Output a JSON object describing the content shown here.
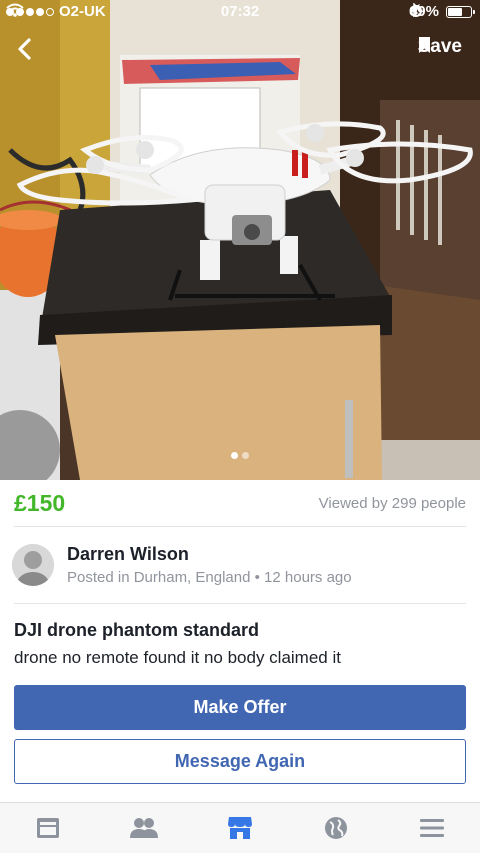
{
  "status_bar": {
    "carrier": "O2-UK",
    "time": "07:32",
    "battery_text": "69%",
    "battery_level": 0.69
  },
  "nav": {
    "save_label": "Save",
    "photo_count": 2,
    "active_photo": 1
  },
  "listing": {
    "price": "£150",
    "views": "Viewed by 299 people",
    "seller_name": "Darren Wilson",
    "seller_meta": "Posted in Durham, England • 12 hours ago",
    "title": "DJI drone phantom standard",
    "description": "drone no remote found it no body claimed it"
  },
  "actions": {
    "primary_label": "Make Offer",
    "secondary_label": "Message Again"
  },
  "tabs": [
    {
      "name": "news-feed-icon",
      "active": false
    },
    {
      "name": "friends-icon",
      "active": false
    },
    {
      "name": "marketplace-icon",
      "active": true
    },
    {
      "name": "notifications-globe-icon",
      "active": false
    },
    {
      "name": "menu-icon",
      "active": false
    }
  ],
  "colors": {
    "price_green": "#42b72a",
    "brand_blue": "#4267b2",
    "muted_gray": "#90949c",
    "active_tab_blue": "#3578e5",
    "inactive_tab_gray": "#8d949e"
  }
}
